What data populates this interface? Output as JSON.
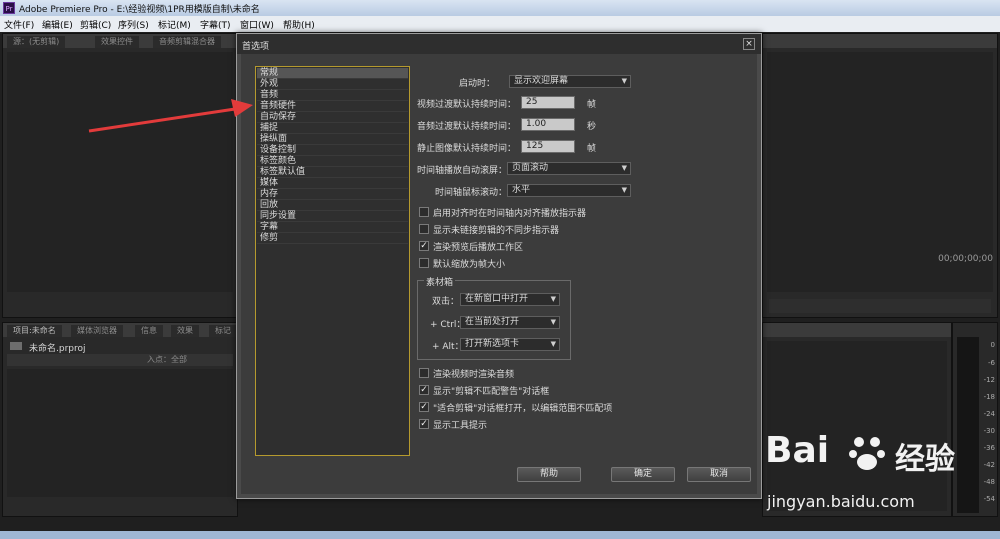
{
  "window": {
    "title": "Adobe Premiere Pro - E:\\经验视频\\1PR用模版自制\\未命名",
    "app_icon": "Pr"
  },
  "menu": [
    "文件(F)",
    "编辑(E)",
    "剪辑(C)",
    "序列(S)",
    "标记(M)",
    "字幕(T)",
    "窗口(W)",
    "帮助(H)"
  ],
  "panels": {
    "source_tabs": [
      "源：(无剪辑)",
      "效果控件",
      "音频剪辑混合器"
    ],
    "timecode": "00;00;00;00",
    "project_tabs": [
      "项目:未命名",
      "媒体浏览器",
      "信息",
      "效果",
      "标记"
    ],
    "project_file": "未命名.prproj",
    "in_point_label": "入点：全部",
    "meter_scale": [
      "0",
      "-6",
      "-12",
      "-18",
      "-24",
      "-30",
      "-36",
      "-42",
      "-48",
      "-54"
    ]
  },
  "dialog": {
    "title": "首选项",
    "close_glyph": "×",
    "categories": [
      "常规",
      "外观",
      "音频",
      "音频硬件",
      "自动保存",
      "捕捉",
      "操纵面",
      "设备控制",
      "标签颜色",
      "标签默认值",
      "媒体",
      "内存",
      "回放",
      "同步设置",
      "字幕",
      "修剪"
    ],
    "selected_category": "常规",
    "startup_label": "启动时：",
    "startup_value": "显示欢迎屏幕",
    "video_transition_label": "视频过渡默认持续时间：",
    "video_transition_value": "25",
    "video_transition_unit": "帧",
    "audio_transition_label": "音频过渡默认持续时间：",
    "audio_transition_value": "1.00",
    "audio_transition_unit": "秒",
    "still_image_label": "静止图像默认持续时间：",
    "still_image_value": "125",
    "still_image_unit": "帧",
    "timeline_scroll_label": "时间轴播放自动滚屏：",
    "timeline_scroll_value": "页面滚动",
    "timeline_mouse_label": "时间轴鼠标滚动：",
    "timeline_mouse_value": "水平",
    "checks": [
      {
        "label": "启用对齐时在时间轴内对齐播放指示器",
        "checked": false
      },
      {
        "label": "显示未链接剪辑的不同步指示器",
        "checked": false
      },
      {
        "label": "渲染预览后播放工作区",
        "checked": true
      },
      {
        "label": "默认缩放为帧大小",
        "checked": false
      }
    ],
    "bin": {
      "title": "素材箱",
      "double_click_label": "双击：",
      "double_click_value": "在新窗口中打开",
      "ctrl_label": "+ Ctrl：",
      "ctrl_value": "在当前处打开",
      "alt_label": "+ Alt：",
      "alt_value": "打开新选项卡"
    },
    "checks2": [
      {
        "label": "渲染视频时渲染音频",
        "checked": false
      },
      {
        "label": "显示\"剪辑不匹配警告\"对话框",
        "checked": true
      },
      {
        "label": "\"适合剪辑\"对话框打开，以编辑范围不匹配项",
        "checked": true
      },
      {
        "label": "显示工具提示",
        "checked": true
      }
    ],
    "buttons": {
      "help": "帮助",
      "ok": "确定",
      "cancel": "取消"
    }
  },
  "watermark": {
    "brand": "Bai",
    "brand2": "经验",
    "url": "jingyan.baidu.com"
  },
  "colors": {
    "accent_arrow": "#e23b3b",
    "list_border": "#b59a2e"
  }
}
